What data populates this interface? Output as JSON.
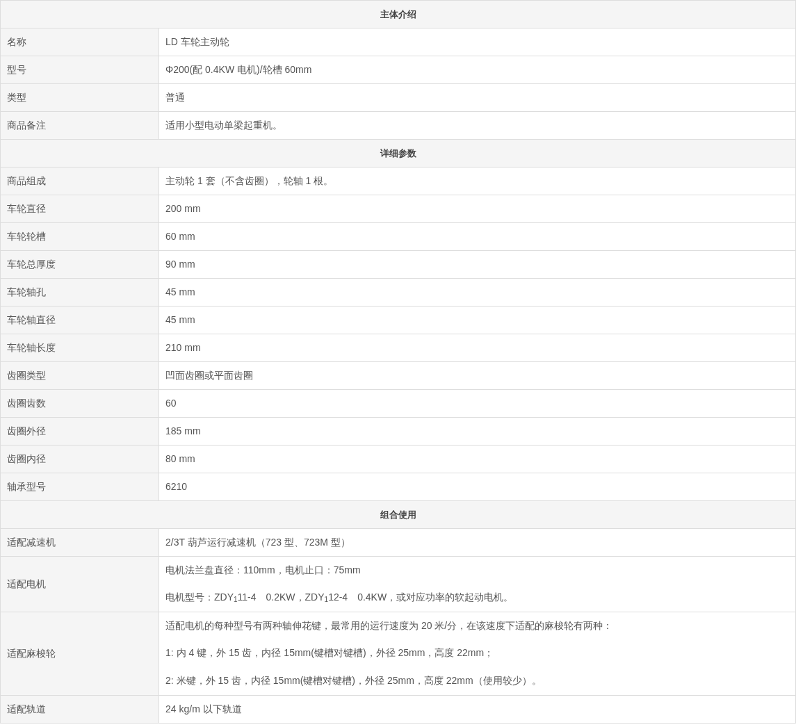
{
  "sections": [
    {
      "title": "主体介绍",
      "rows": [
        {
          "label": "名称",
          "values": [
            "LD 车轮主动轮"
          ]
        },
        {
          "label": "型号",
          "values": [
            "Φ200(配 0.4KW 电机)/轮槽 60mm"
          ]
        },
        {
          "label": "类型",
          "values": [
            "普通"
          ]
        },
        {
          "label": "商品备注",
          "values": [
            "适用小型电动单梁起重机。"
          ]
        }
      ]
    },
    {
      "title": "详细参数",
      "rows": [
        {
          "label": "商品组成",
          "values": [
            "主动轮 1 套（不含齿圈），轮轴 1 根。"
          ]
        },
        {
          "label": "车轮直径",
          "values": [
            "200 mm"
          ]
        },
        {
          "label": "车轮轮槽",
          "values": [
            "60 mm"
          ]
        },
        {
          "label": "车轮总厚度",
          "values": [
            "90 mm"
          ]
        },
        {
          "label": "车轮轴孔",
          "values": [
            "45 mm"
          ]
        },
        {
          "label": "车轮轴直径",
          "values": [
            "45 mm"
          ]
        },
        {
          "label": "车轮轴长度",
          "values": [
            "210 mm"
          ]
        },
        {
          "label": "齿圈类型",
          "values": [
            "凹面齿圈或平面齿圈"
          ]
        },
        {
          "label": "齿圈齿数",
          "values": [
            "60"
          ]
        },
        {
          "label": "齿圈外径",
          "values": [
            "185 mm"
          ]
        },
        {
          "label": "齿圈内径",
          "values": [
            "80 mm"
          ]
        },
        {
          "label": "轴承型号",
          "values": [
            "6210"
          ]
        }
      ]
    },
    {
      "title": "组合使用",
      "rows": [
        {
          "label": "适配减速机",
          "values": [
            "2/3T 葫芦运行减速机（723 型、723M 型）"
          ]
        },
        {
          "label": "适配电机",
          "values": [
            "电机法兰盘直径：110mm，电机止口：75mm",
            "电机型号：ZDY$_{1}$11-4　0.2KW，ZDY$_{1}$12-4　0.4KW，或对应功率的软起动电机。"
          ]
        },
        {
          "label": "适配麻梭轮",
          "values": [
            "适配电机的每种型号有两种轴伸花键，最常用的运行速度为 20 米/分，在该速度下适配的麻梭轮有两种：",
            "1:  内 4 键，外 15 齿，内径 15mm(键槽对键槽)，外径 25mm，高度 22mm；",
            "2:  米键，外 15 齿，内径 15mm(键槽对键槽)，外径 25mm，高度 22mm（使用较少）。"
          ]
        },
        {
          "label": "适配轨道",
          "values": [
            "24 kg/m 以下轨道"
          ]
        }
      ]
    }
  ]
}
